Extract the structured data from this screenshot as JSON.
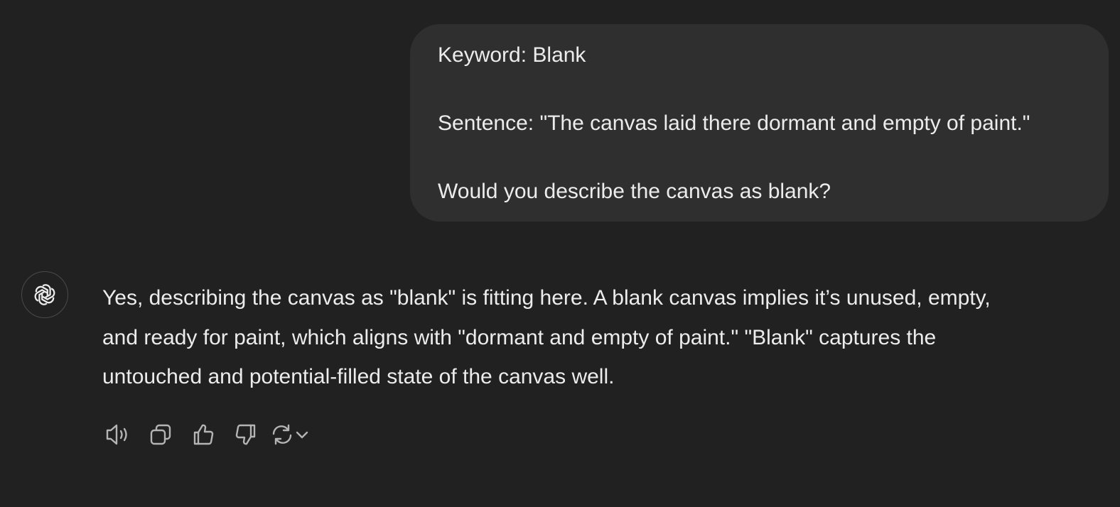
{
  "user_message": {
    "lines": [
      "Keyword: Blank",
      "Sentence: \"The canvas laid there dormant and empty of paint.\"",
      "Would you describe the canvas as blank?"
    ]
  },
  "assistant_message": {
    "avatar_icon": "openai-logo-icon",
    "lines": [
      "Yes, describing the canvas as \"blank\" is fitting here. A blank canvas implies it’s unused, empty,",
      "and ready for paint, which aligns with \"dormant and empty of paint.\" \"Blank\" captures the",
      "untouched and potential-filled state of the canvas well."
    ]
  },
  "actions": {
    "icons": [
      "speaker-icon",
      "copy-icon",
      "thumbs-up-icon",
      "thumbs-down-icon",
      "regenerate-icon",
      "chevron-down-icon"
    ]
  },
  "colors": {
    "background": "#212121",
    "user_bubble": "#2f2f2f",
    "text": "#ececec",
    "icon": "#b4b4b4"
  }
}
